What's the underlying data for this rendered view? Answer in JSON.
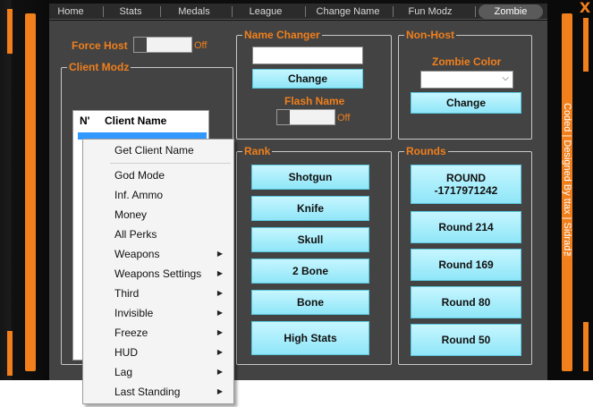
{
  "window": {
    "close_label": "X",
    "credits": "Coded | Designed By ttax | Sidrad™"
  },
  "tabs": [
    {
      "label": "Home"
    },
    {
      "label": "Stats"
    },
    {
      "label": "Medals"
    },
    {
      "label": "League"
    },
    {
      "label": "Change Name"
    },
    {
      "label": "Fun Modz"
    },
    {
      "label": "Zombie"
    }
  ],
  "active_tab": "Zombie",
  "force_host": {
    "label": "Force Host",
    "state": "Off"
  },
  "client_modz": {
    "title": "Client Modz",
    "columns": [
      "N'",
      "Client Name"
    ]
  },
  "name_changer": {
    "title": "Name Changer",
    "name_value": "",
    "change_label": "Change",
    "flash_label": "Flash Name",
    "flash_state": "Off"
  },
  "non_host": {
    "title": "Non-Host",
    "zombie_color_label": "Zombie Color",
    "zombie_color_value": "",
    "change_label": "Change"
  },
  "rank": {
    "title": "Rank",
    "buttons": [
      "Shotgun",
      "Knife",
      "Skull",
      "2 Bone",
      "Bone",
      "High Stats"
    ]
  },
  "rounds": {
    "title": "Rounds",
    "buttons": [
      "ROUND\n-1717971242",
      "Round 214",
      "Round 169",
      "Round 80",
      "Round 50"
    ]
  },
  "context_menu": {
    "items": [
      {
        "label": "Get Client Name",
        "submenu": false
      },
      {
        "label": "God Mode",
        "submenu": false
      },
      {
        "label": "Inf. Ammo",
        "submenu": false
      },
      {
        "label": "Money",
        "submenu": false
      },
      {
        "label": "All Perks",
        "submenu": false
      },
      {
        "label": "Weapons",
        "submenu": true
      },
      {
        "label": "Weapons Settings",
        "submenu": true
      },
      {
        "label": "Third",
        "submenu": true
      },
      {
        "label": "Invisible",
        "submenu": true
      },
      {
        "label": "Freeze",
        "submenu": true
      },
      {
        "label": "HUD",
        "submenu": true
      },
      {
        "label": "Lag",
        "submenu": true
      },
      {
        "label": "Last Standing",
        "submenu": true
      }
    ],
    "submenu_arrow": "▶"
  },
  "colors": {
    "accent": "#f07f1c",
    "button": "#aeeefb",
    "panel": "#434343"
  }
}
